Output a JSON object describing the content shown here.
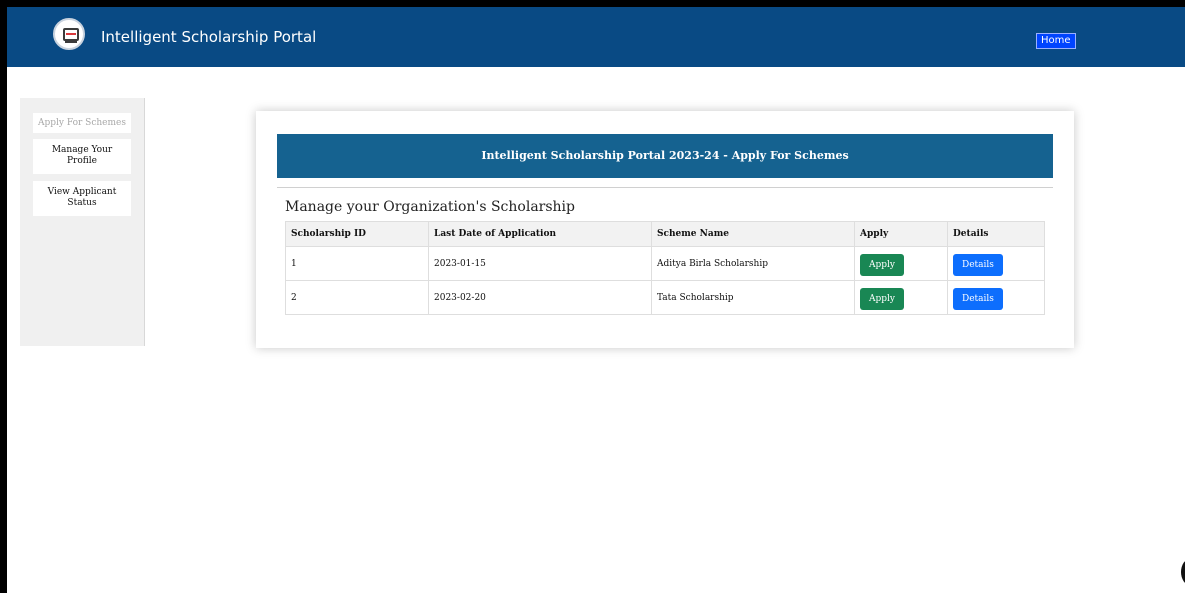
{
  "navbar": {
    "brand": "Intelligent Scholarship Portal",
    "home_label": "Home",
    "background": "#094a84"
  },
  "sidebar": {
    "items": [
      {
        "label": "Apply For Schemes",
        "active": true
      },
      {
        "label": "Manage Your Profile",
        "active": false
      },
      {
        "label": "View Applicant Status",
        "active": false
      }
    ]
  },
  "card": {
    "header": "Intelligent Scholarship Portal 2023-24 - Apply For Schemes",
    "title": "Manage your Organization's Scholarship"
  },
  "table": {
    "headers": [
      "Scholarship ID",
      "Last Date of Application",
      "Scheme Name",
      "Apply",
      "Details"
    ],
    "rows": [
      {
        "id": "1",
        "last_date": "2023-01-15",
        "scheme": "Aditya Birla Scholarship",
        "apply_label": "Apply",
        "details_label": "Details"
      },
      {
        "id": "2",
        "last_date": "2023-02-20",
        "scheme": "Tata Scholarship",
        "apply_label": "Apply",
        "details_label": "Details"
      }
    ]
  },
  "colors": {
    "header_bar": "#156290",
    "apply_button": "#198754",
    "details_button": "#0d6efd"
  }
}
